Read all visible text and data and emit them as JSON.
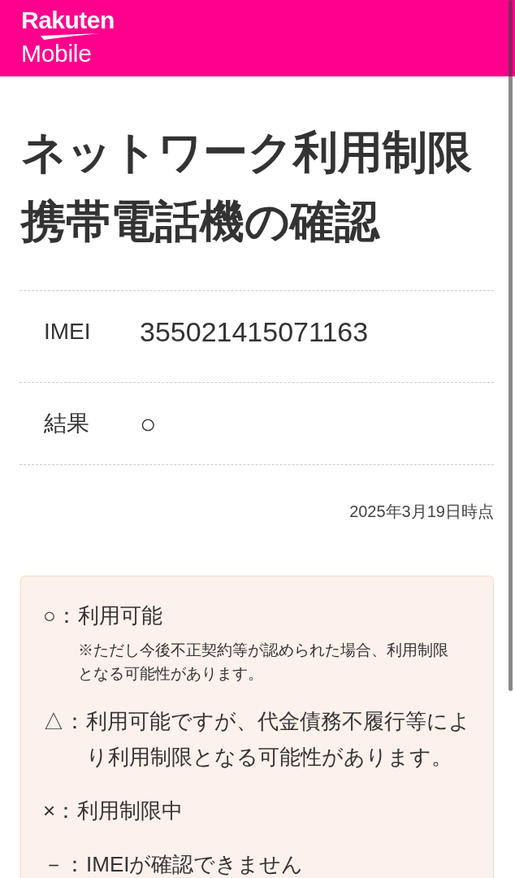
{
  "header": {
    "logo_top": "Rakuten",
    "logo_bottom": "Mobile"
  },
  "title": "ネットワーク利用制限携帯電話機の確認",
  "details": [
    {
      "label": "IMEI",
      "value": "355021415071163"
    },
    {
      "label": "結果",
      "value": "○"
    }
  ],
  "as_of": "2025年3月19日時点",
  "legend": [
    {
      "mark": "○",
      "separator": "：",
      "text": "利用可能",
      "note": "※ただし今後不正契約等が認められた場合、利用制限となる可能性があります。"
    },
    {
      "mark": "△",
      "separator": "：",
      "text": "利用可能ですが、代金債務不履行等により利用制限となる可能性があります。"
    },
    {
      "mark": "×",
      "separator": "：",
      "text": "利用制限中"
    },
    {
      "mark": "－",
      "separator": "：",
      "text": "IMEIが確認できません"
    }
  ]
}
